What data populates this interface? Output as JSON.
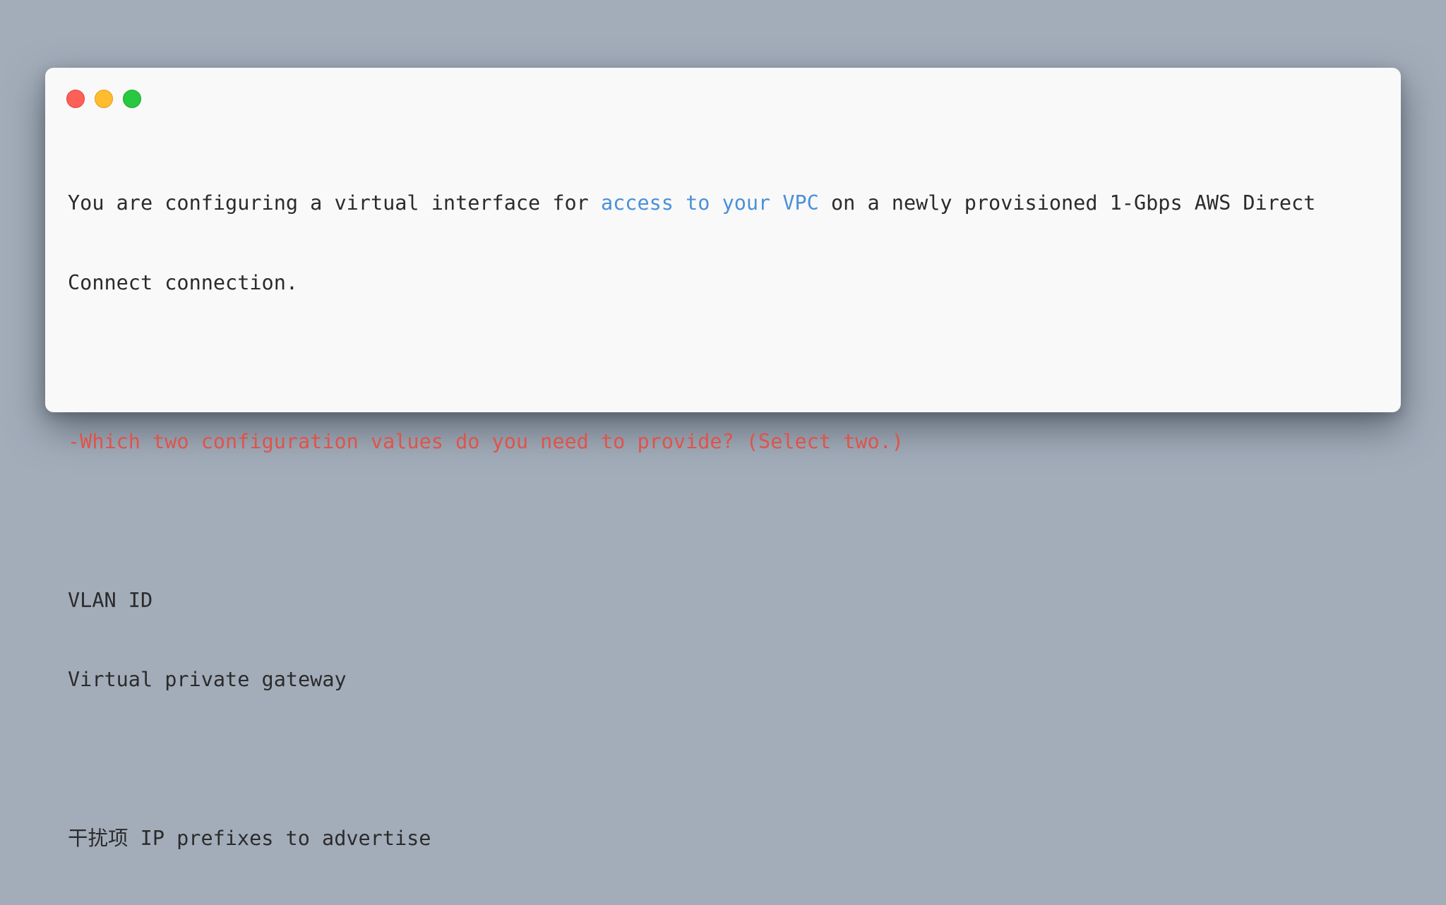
{
  "window": {
    "traffic_lights": [
      "close",
      "minimize",
      "maximize"
    ]
  },
  "content": {
    "intro_part1": "You are configuring a virtual interface for ",
    "intro_link": "access to your VPC",
    "intro_part2": " on a newly provisioned 1-Gbps AWS Direct",
    "intro_line2": "Connect connection.",
    "question": "-Which two configuration values do you need to provide? (Select two.)",
    "answers": [
      "VLAN ID",
      "Virtual private gateway"
    ],
    "distractor": "干扰项 IP prefixes to advertise"
  },
  "colors": {
    "background": "#a3adba",
    "window": "#f9f9f9",
    "text": "#2b2b2b",
    "link": "#4a90d9",
    "question": "#e0534a"
  }
}
